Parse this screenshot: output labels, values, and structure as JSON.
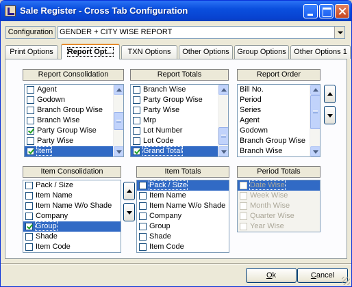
{
  "window": {
    "title": "Sale Register - Cross Tab Configuration"
  },
  "config": {
    "label": "Configuration",
    "value": "GENDER + CITY WISE REPORT"
  },
  "tabs": [
    {
      "label": "Print Options"
    },
    {
      "label": "Report Opt...",
      "active": true
    },
    {
      "label": "TXN Options"
    },
    {
      "label": "Other Options"
    },
    {
      "label": "Group Options"
    },
    {
      "label": "Other Options 1"
    }
  ],
  "report_consolidation": {
    "title": "Report Consolidation",
    "items": [
      {
        "label": "Agent",
        "checked": false
      },
      {
        "label": "Godown",
        "checked": false
      },
      {
        "label": "Branch Group Wise",
        "checked": false
      },
      {
        "label": "Branch Wise",
        "checked": false
      },
      {
        "label": "Party Group Wise",
        "checked": true
      },
      {
        "label": "Party Wise",
        "checked": false
      },
      {
        "label": "Item",
        "checked": true,
        "selected": true
      }
    ]
  },
  "report_totals": {
    "title": "Report Totals",
    "items": [
      {
        "label": "Branch Wise",
        "checked": false
      },
      {
        "label": "Party Group Wise",
        "checked": false
      },
      {
        "label": "Party Wise",
        "checked": false
      },
      {
        "label": "Mrp",
        "checked": false
      },
      {
        "label": "Lot Number",
        "checked": false
      },
      {
        "label": "Lot Code",
        "checked": false
      },
      {
        "label": "Grand Total",
        "checked": true,
        "selected": true
      }
    ]
  },
  "report_order": {
    "title": "Report Order",
    "items": [
      "Bill No.",
      "Period",
      "Series",
      "Agent",
      "Godown",
      "Branch Group Wise",
      "Branch Wise",
      "Party Group Wise"
    ]
  },
  "item_consolidation": {
    "title": "Item Consolidation",
    "items": [
      {
        "label": "Pack / Size",
        "checked": false
      },
      {
        "label": "Item Name",
        "checked": false
      },
      {
        "label": "Item Name W/o Shade",
        "checked": false
      },
      {
        "label": "Company",
        "checked": false
      },
      {
        "label": "Group",
        "checked": true,
        "selected": true
      },
      {
        "label": "Shade",
        "checked": false
      },
      {
        "label": "Item Code",
        "checked": false
      }
    ]
  },
  "item_totals": {
    "title": "Item Totals",
    "items": [
      {
        "label": "Pack / Size",
        "checked": false,
        "selected": true
      },
      {
        "label": "Item Name",
        "checked": false
      },
      {
        "label": "Item Name W/o Shade",
        "checked": false
      },
      {
        "label": "Company",
        "checked": false
      },
      {
        "label": "Group",
        "checked": false
      },
      {
        "label": "Shade",
        "checked": false
      },
      {
        "label": "Item Code",
        "checked": false
      }
    ]
  },
  "period_totals": {
    "title": "Period Totals",
    "items": [
      {
        "label": "Date Wise",
        "checked": false,
        "selected": true
      },
      {
        "label": "Week Wise",
        "checked": false
      },
      {
        "label": "Month Wise",
        "checked": false
      },
      {
        "label": "Quarter Wise",
        "checked": false
      },
      {
        "label": "Year Wise",
        "checked": false
      }
    ]
  },
  "buttons": {
    "ok": {
      "accel": "O",
      "rest": "k"
    },
    "cancel": {
      "accel": "C",
      "rest": "ancel"
    }
  }
}
